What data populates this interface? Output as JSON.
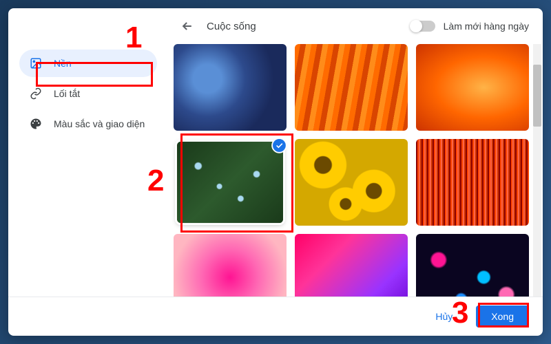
{
  "header": {
    "title": "Cuộc sống",
    "toggle_label": "Làm mới hàng ngày"
  },
  "sidebar": {
    "items": [
      {
        "label": "Nền"
      },
      {
        "label": "Lối tắt"
      },
      {
        "label": "Màu sắc và giao diện"
      }
    ]
  },
  "footer": {
    "cancel_label": "Hủy",
    "done_label": "Xong"
  },
  "annotations": {
    "one": "1",
    "two": "2",
    "three": "3"
  }
}
